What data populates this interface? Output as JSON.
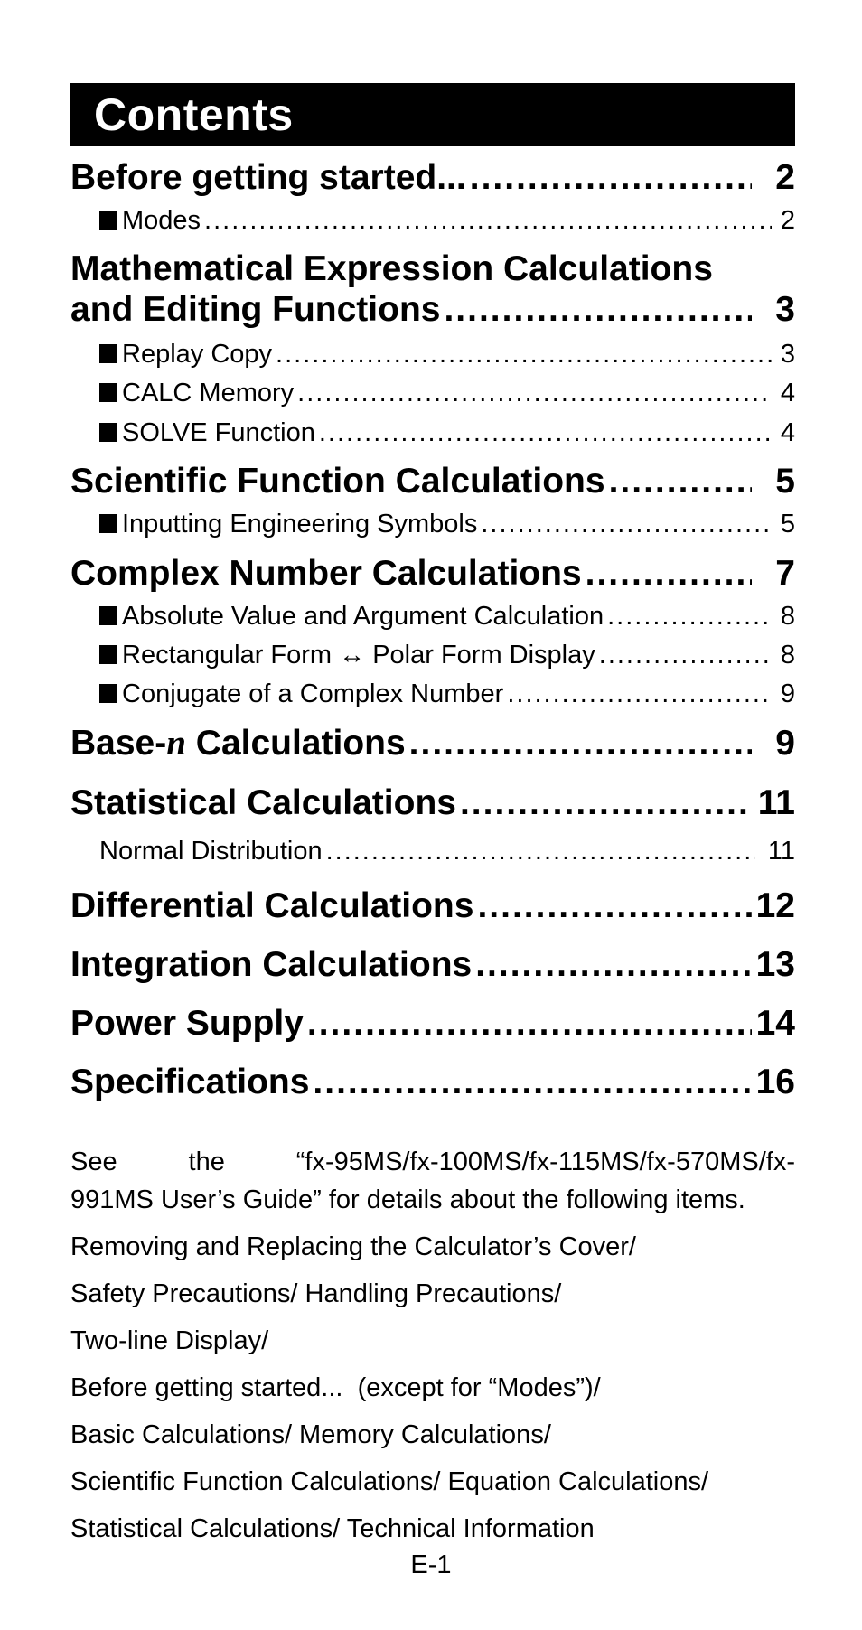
{
  "header": {
    "title": "Contents"
  },
  "toc": {
    "before": {
      "label": "Before getting started...",
      "page": "2"
    },
    "modes": {
      "label": "Modes",
      "page": "2"
    },
    "math_line1": "Mathematical Expression Calculations",
    "math": {
      "label": "and Editing Functions",
      "page": "3"
    },
    "replay": {
      "label": "Replay Copy",
      "page": "3"
    },
    "calc": {
      "label": "CALC Memory",
      "page": "4"
    },
    "solve": {
      "label": "SOLVE Function",
      "page": "4"
    },
    "scientific": {
      "label": "Scientific Function Calculations",
      "page": "5"
    },
    "engineering": {
      "label": "Inputting Engineering Symbols",
      "page": "5"
    },
    "complex": {
      "label": "Complex Number Calculations",
      "page": "7"
    },
    "absolute": {
      "label": "Absolute Value and Argument Calculation",
      "page": "8"
    },
    "rect": {
      "label": "Rectangular Form ↔ Polar Form Display",
      "page": "8"
    },
    "conjugate": {
      "label": "Conjugate of a Complex Number",
      "page": "9"
    },
    "basen": {
      "label_prefix": "Base-",
      "label_italic": "n",
      "label_suffix": " Calculations",
      "page": "9"
    },
    "statistical": {
      "label": "Statistical Calculations",
      "page": "11"
    },
    "normal": {
      "label": "Normal Distribution",
      "page": "11"
    },
    "differential": {
      "label": "Differential Calculations",
      "page": "12"
    },
    "integration": {
      "label": "Integration Calculations",
      "page": "13"
    },
    "power": {
      "label": "Power Supply",
      "page": "14"
    },
    "specs": {
      "label": "Specifications",
      "page": "16"
    }
  },
  "note": {
    "line1": "See the “fx-95MS/fx-100MS/fx-115MS/fx-570MS/fx-",
    "line2": "991MS User’s Guide” for details about the following items.",
    "items": [
      "Removing and Replacing the Calculator’s Cover/",
      "Safety Precautions/ Handling Precautions/",
      "Two-line Display/",
      "Before getting started...  (except for “Modes”)/",
      "Basic Calculations/ Memory Calculations/",
      "Scientific Function Calculations/ Equation Calculations/",
      "Statistical Calculations/ Technical Information"
    ]
  },
  "footer": {
    "page_number": "E-1"
  }
}
